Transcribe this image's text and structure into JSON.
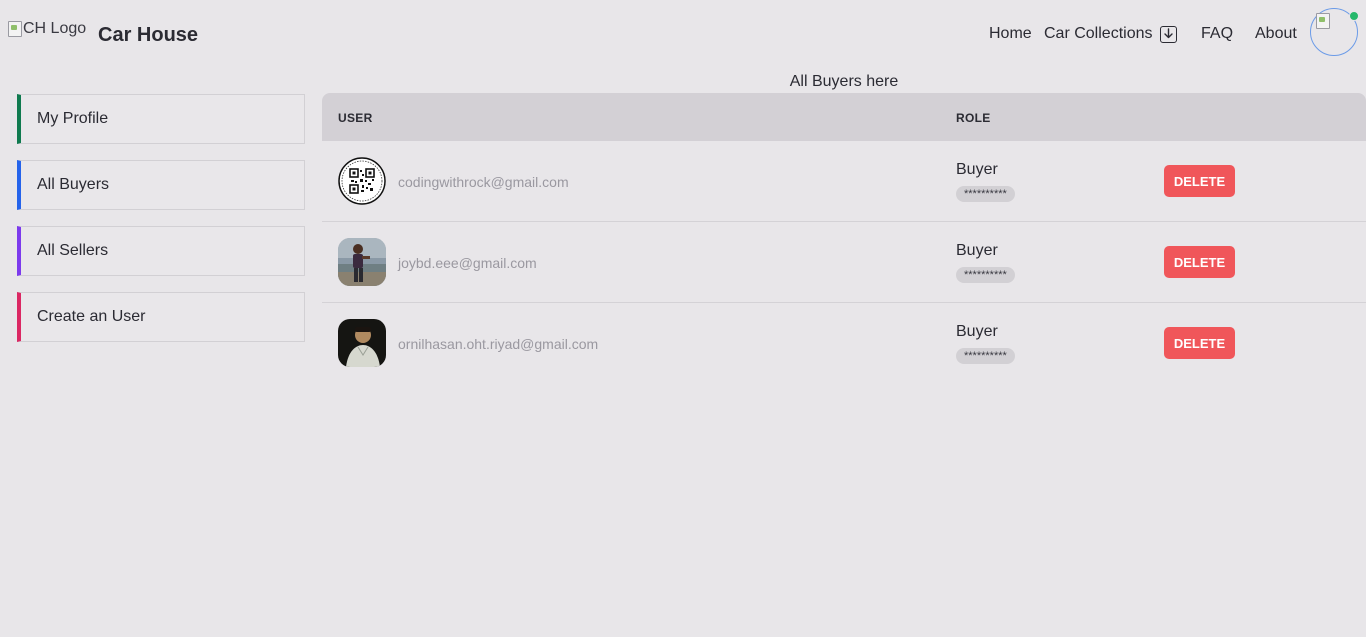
{
  "header": {
    "logo_alt": "CH Logo",
    "brand_title": "Car House",
    "nav": {
      "home": "Home",
      "car_collections": "Car Collections",
      "faq": "FAQ",
      "about": "About"
    },
    "icons": {
      "download": "download-box-icon",
      "avatar_status": "online-status-dot"
    },
    "status_color": "#26b86b"
  },
  "sidebar": {
    "items": [
      {
        "label": "My Profile",
        "accent": "#0f7a4f"
      },
      {
        "label": "All Buyers",
        "accent": "#2563eb"
      },
      {
        "label": "All Sellers",
        "accent": "#7c3aed"
      },
      {
        "label": "Create an User",
        "accent": "#db2763"
      }
    ]
  },
  "main": {
    "heading": "All Buyers here",
    "table": {
      "columns": {
        "user": "USER",
        "role": "ROLE"
      },
      "rows": [
        {
          "email": "codingwithrock@gmail.com",
          "role": "Buyer",
          "password_mask": "**********",
          "action": "DELETE",
          "avatar": "qr-code-avatar"
        },
        {
          "email": "joybd.eee@gmail.com",
          "role": "Buyer",
          "password_mask": "**********",
          "action": "DELETE",
          "avatar": "person-photo-avatar"
        },
        {
          "email": "ornilhasan.oht.riyad@gmail.com",
          "role": "Buyer",
          "password_mask": "**********",
          "action": "DELETE",
          "avatar": "person-photo-avatar"
        }
      ]
    },
    "delete_color": "#f0565a"
  }
}
